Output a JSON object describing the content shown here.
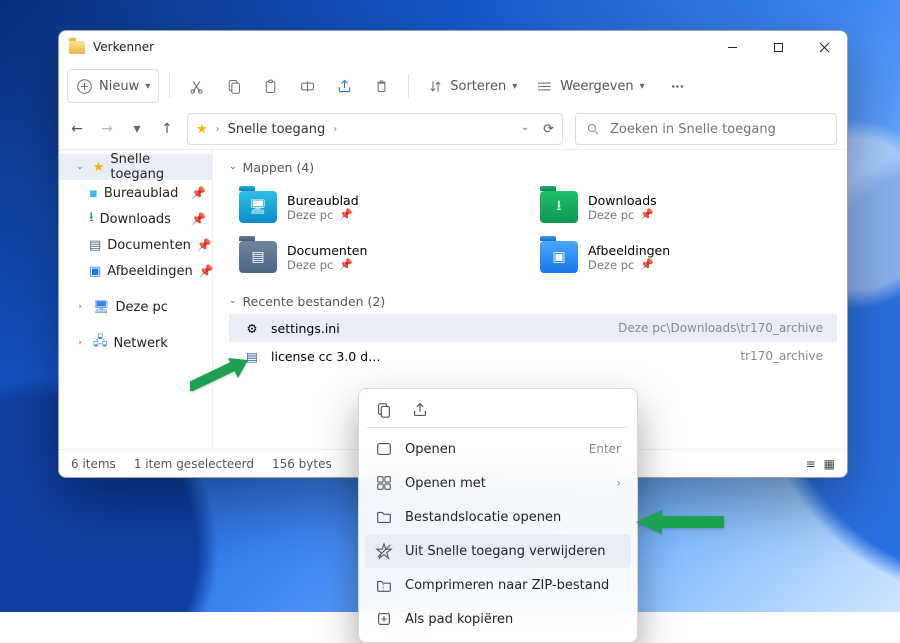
{
  "window_title": "Verkenner",
  "toolbar": {
    "new": "Nieuw",
    "sort": "Sorteren",
    "view": "Weergeven"
  },
  "address": {
    "root": "Snelle toegang"
  },
  "search": {
    "placeholder": "Zoeken in Snelle toegang"
  },
  "sidebar": {
    "items": [
      {
        "label": "Snelle toegang"
      },
      {
        "label": "Bureaublad"
      },
      {
        "label": "Downloads"
      },
      {
        "label": "Documenten"
      },
      {
        "label": "Afbeeldingen"
      },
      {
        "label": "Deze pc"
      },
      {
        "label": "Netwerk"
      }
    ]
  },
  "groups": {
    "folders_head": "Mappen (4)",
    "recent_head": "Recente bestanden (2)",
    "subloc": "Deze pc"
  },
  "folders": [
    {
      "name": "Bureaublad"
    },
    {
      "name": "Downloads"
    },
    {
      "name": "Documenten"
    },
    {
      "name": "Afbeeldingen"
    }
  ],
  "files": [
    {
      "name": "settings.ini",
      "path": "Deze pc\\Downloads\\tr170_archive"
    },
    {
      "name": "license cc 3.0 d…",
      "path": "tr170_archive"
    }
  ],
  "status": {
    "items": "6 items",
    "selected": "1 item geselecteerd",
    "size": "156 bytes"
  },
  "context_menu": {
    "open": "Openen",
    "open_hint": "Enter",
    "open_with": "Openen met",
    "open_location": "Bestandslocatie openen",
    "remove_quick": "Uit Snelle toegang verwijderen",
    "compress": "Comprimeren naar ZIP-bestand",
    "copy_path": "Als pad kopiëren"
  }
}
